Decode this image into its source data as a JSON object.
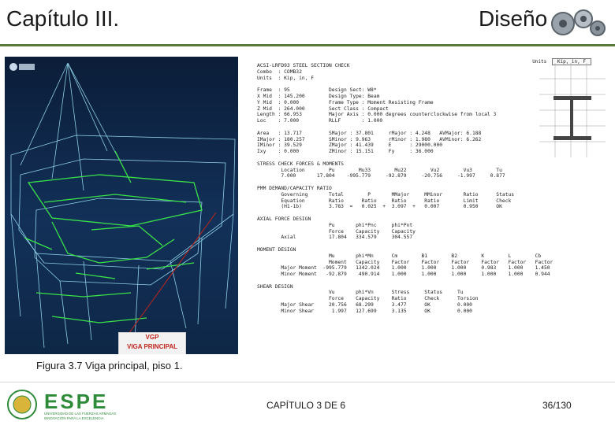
{
  "header": {
    "chapter_title": "Capítulo III.",
    "section_title": "Diseño"
  },
  "figure": {
    "label_vgp": "VGP",
    "label_viga_principal": "VIGA PRINCIPAL",
    "caption": "Figura 3.7 Viga principal, piso 1."
  },
  "report": {
    "units_label": "Units",
    "units_value": "Kip, in, F",
    "text": "ACSI-LRFD93 STEEL SECTION CHECK\nCombo  : COMB32\nUnits  : Kip, in, F\n\nFrame  : 95             Design Sect: W8*\nX Mid  : 145.200        Design Type: Beam\nY Mid  : 0.000          Frame Type : Moment Resisting Frame\nZ Mid  : 264.000        Sect Class : Compact\nLength : 66.953         Major Axis : 0.000 degrees counterclockwise from local 3\nLoc    : 7.000          RLLF       : 1.000\n\nArea   : 13.717         SMajor : 37.801     rMajor : 4.248   AVMajor: 6.188\nIMajor : 180.257        SMinor : 9.963      rMinor : 1.980   AVMinor: 6.262\nIMinor : 39.529         ZMajor : 41.439     E      : 29000.000\nIxy    : 0.000          ZMinor : 15.151     Fy     : 36.000\n\nSTRESS CHECK FORCES & MOMENTS\n        Location        Pu        Mu33        Mu22        Vu2        Vu3        Tu\n        7.000       17.804    -995.779     -92.879     -20.756     -1.997     0.877\n\nPMM DEMAND/CAPACITY RATIO\n        Governing       Total        P       MMajor     MMinor       Ratio      Status\n        Equation        Ratio      Ratio     Ratio      Ratio        Limit      Check\n        (H1-1b)         3.783  =   0.025  +  3.097  +   0.007        0.950      OK\n\nAXIAL FORCE DESIGN\n                        Pu       phi*Pnc     phi*Pnt\n                        Force    Capacity    Capacity\n        Axial           17.804   334.579     304.557\n\nMOMENT DESIGN\n                        Mu       phi*Mn      Cm        B1        B2        K        L        Cb\n                        Moment   Capacity    Factor    Factor    Factor    Factor   Factor   Factor\n        Major Moment  -995.779   1342.024    1.000     1.000     1.000     0.983    1.000    1.450\n        Minor Moment   -92.879    490.914    1.000     1.000     1.000     1.000    1.000    0.944\n\nSHEAR DESIGN\n                        Vu       phi*Vn      Stress     Status     Tu\n                        Force    Capacity    Ratio      Check      Torsion\n        Major Shear     20.756   68.299      3.477      OK         0.000\n        Minor Shear      1.997   127.699     3.135      OK         0.000"
  },
  "footer": {
    "logo_text": "ESPE",
    "logo_subtitle": "UNIVERSIDAD DE LAS FUERZAS ARMADAS",
    "logo_motto": "INNOVACIÓN PARA LA EXCELENCIA",
    "center_text": "CAPÍTULO 3 DE 6",
    "page": "36/130"
  },
  "colors": {
    "model_bg": "#0e2747",
    "structure_lines": "#8fd0e6",
    "members_green": "#3be34a",
    "annotation_red": "#c0261d",
    "logo_green": "#2e8b3a",
    "header_rule": "#5a7a3a"
  }
}
